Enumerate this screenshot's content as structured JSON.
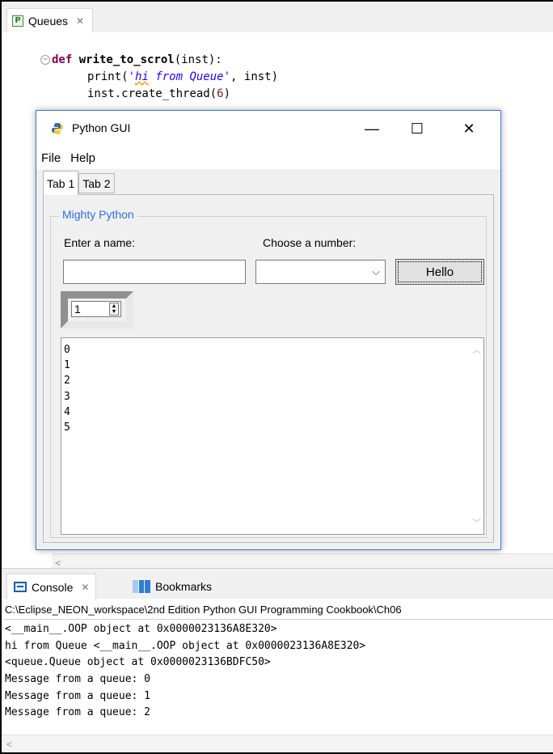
{
  "editor": {
    "tab_label": "Queues",
    "tab_icon": "P",
    "tab_close": "✕",
    "code_lines": [
      {
        "kw": "def ",
        "fn": "write_to_scrol",
        "rest": "(inst):"
      },
      {
        "pre": "print(",
        "str_q": "'",
        "str_hi": "hi",
        "str_rest": " from Queue'",
        "post": ", inst)"
      },
      {
        "pre": "inst.create_thread(",
        "num": "6",
        "post": ")"
      }
    ]
  },
  "gui": {
    "title": "Python GUI",
    "btn_minimize": "—",
    "btn_maximize": "☐",
    "btn_close": "✕",
    "menu": [
      "File",
      "Help"
    ],
    "tabs": [
      "Tab 1",
      "Tab 2"
    ],
    "group_label": "Mighty Python",
    "name_label": "Enter a name:",
    "number_label": "Choose a number:",
    "name_value": "",
    "combo_value": "",
    "hello_label": "Hello",
    "spin_value": "1",
    "scrolled_lines": [
      "0",
      "1",
      "2",
      "3",
      "4",
      "5"
    ]
  },
  "console": {
    "tab_label": "Console",
    "tab_close": "✕",
    "bookmarks_label": "Bookmarks",
    "path": "C:\\Eclipse_NEON_workspace\\2nd Edition Python GUI Programming Cookbook\\Ch06",
    "output": [
      "<__main__.OOP object at 0x0000023136A8E320>",
      "hi from Queue <__main__.OOP object at 0x0000023136A8E320>",
      "<queue.Queue object at 0x0000023136BDFC50>",
      "Message from a queue: 0",
      "Message from a queue: 1",
      "Message from a queue: 2"
    ]
  }
}
